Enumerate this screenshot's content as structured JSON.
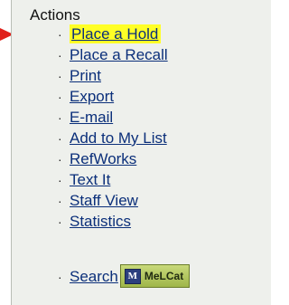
{
  "panel": {
    "heading": "Actions",
    "items": [
      {
        "label": "Place a Hold",
        "highlighted": true
      },
      {
        "label": "Place a Recall"
      },
      {
        "label": "Print"
      },
      {
        "label": "Export"
      },
      {
        "label": "E-mail"
      },
      {
        "label": "Add to My List"
      },
      {
        "label": "RefWorks"
      },
      {
        "label": "Text It"
      },
      {
        "label": "Staff View"
      },
      {
        "label": "Statistics"
      }
    ],
    "bullet": "·",
    "search": {
      "label": "Search",
      "badge_text": "MeLCat",
      "badge_icon": "M"
    }
  },
  "colors": {
    "highlight": "#ffff26",
    "arrow": "#e0201b",
    "link": "#0b2f7a"
  }
}
